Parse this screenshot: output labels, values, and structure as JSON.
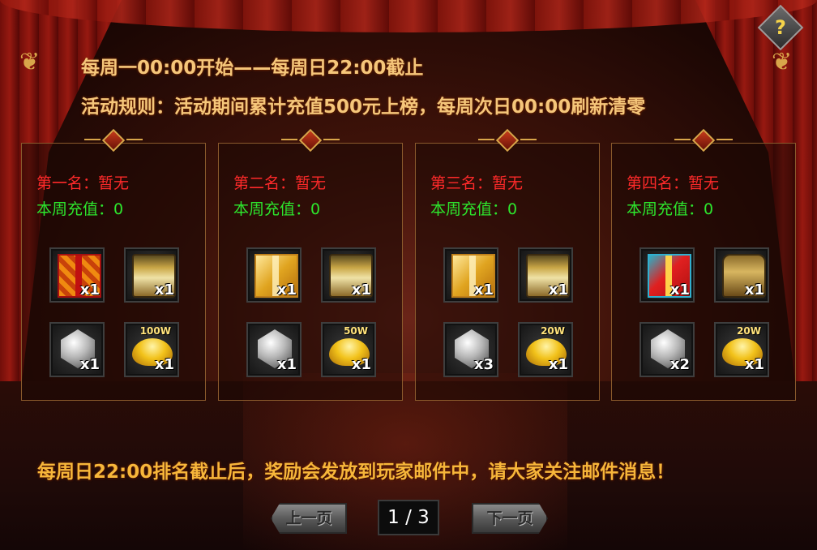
{
  "header": {
    "time_line": "每周一00:00开始——每周日22:00截止",
    "rule_line": "活动规则：活动期间累计充值500元上榜，每周次日00:00刷新清零"
  },
  "help_button": {
    "label": "?",
    "icon": "question-mark-icon"
  },
  "panels": [
    {
      "rank": "第一名：暂无",
      "charge": "本周充值：0",
      "items": [
        {
          "icon": "gift-box-red-icon",
          "qty": "x1"
        },
        {
          "icon": "treasure-chest-open-icon",
          "qty": "x1"
        },
        {
          "icon": "diamond-icon",
          "qty": "x1"
        },
        {
          "icon": "gold-ingot-icon",
          "qty": "x1",
          "label": "100W"
        }
      ]
    },
    {
      "rank": "第二名：暂无",
      "charge": "本周充值：0",
      "items": [
        {
          "icon": "gift-box-gold-icon",
          "qty": "x1"
        },
        {
          "icon": "treasure-chest-open-icon",
          "qty": "x1"
        },
        {
          "icon": "diamond-icon",
          "qty": "x1"
        },
        {
          "icon": "gold-ingot-icon",
          "qty": "x1",
          "label": "50W"
        }
      ]
    },
    {
      "rank": "第三名：暂无",
      "charge": "本周充值：0",
      "items": [
        {
          "icon": "gift-box-gold-icon",
          "qty": "x1"
        },
        {
          "icon": "treasure-chest-open-icon",
          "qty": "x1"
        },
        {
          "icon": "diamond-icon",
          "qty": "x3"
        },
        {
          "icon": "gold-ingot-icon",
          "qty": "x1",
          "label": "20W"
        }
      ]
    },
    {
      "rank": "第四名：暂无",
      "charge": "本周充值：0",
      "items": [
        {
          "icon": "gift-box-blue-icon",
          "qty": "x1"
        },
        {
          "icon": "treasure-chest-closed-icon",
          "qty": "x1"
        },
        {
          "icon": "diamond-icon",
          "qty": "x2"
        },
        {
          "icon": "gold-ingot-icon",
          "qty": "x1",
          "label": "20W"
        }
      ]
    }
  ],
  "footer": {
    "notice": "每周日22:00排名截止后，奖励会发放到玩家邮件中，请大家关注邮件消息！",
    "prev_label": "上一页",
    "next_label": "下一页",
    "page_indicator": "1 / 3"
  },
  "colors": {
    "rank_red": "#ff2a2a",
    "charge_green": "#2de62d",
    "title_gold": "#f5c67a",
    "notice_orange": "#f7b63a"
  }
}
